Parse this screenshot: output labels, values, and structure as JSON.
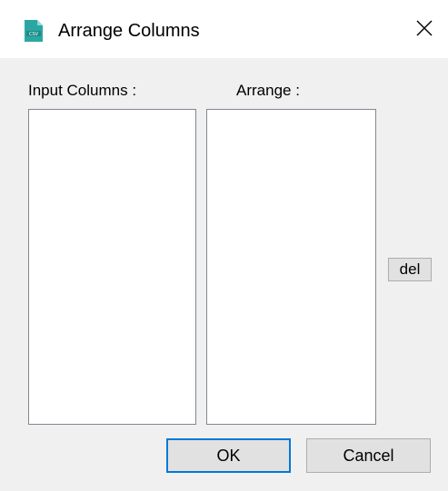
{
  "window": {
    "title": "Arrange Columns",
    "icon": "csv-file-icon",
    "close_glyph": "✕"
  },
  "labels": {
    "input_columns": "Input Columns :",
    "arrange": "Arrange :"
  },
  "lists": {
    "input_columns_items": [],
    "arrange_items": []
  },
  "buttons": {
    "del": "del",
    "ok": "OK",
    "cancel": "Cancel"
  },
  "colors": {
    "accent": "#0078d7",
    "icon_teal": "#2aa7a3"
  }
}
